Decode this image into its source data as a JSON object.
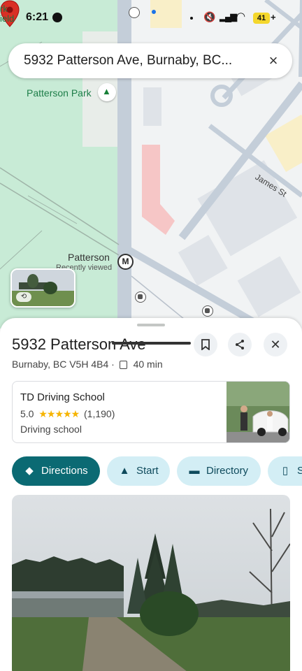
{
  "status_bar": {
    "corner_text": "rk\nield",
    "time": "6:21",
    "battery": "41",
    "battery_suffix": "+"
  },
  "search": {
    "query": "5932 Patterson Ave, Burnaby, BC...",
    "close_icon": "×"
  },
  "map": {
    "park_label": "Patterson Park",
    "street_label": "James St",
    "station_label": "Patterson",
    "recently_viewed": "Recently viewed",
    "metro_symbol": "M",
    "colors": {
      "park": "#c8ebd6",
      "road": "#c4ced9",
      "pin": "#d93025"
    }
  },
  "place": {
    "title": "5932 Patterson Ave",
    "address": "Burnaby, BC V5H 4B4 ·",
    "transit_time": "40 min"
  },
  "business": {
    "name": "TD Driving School",
    "rating": "5.0",
    "stars": "★★★★★",
    "reviews": "(1,190)",
    "category": "Driving school"
  },
  "actions": {
    "directions": "Directions",
    "start": "Start",
    "directory": "Directory",
    "save": "Sa"
  },
  "icons": {
    "bookmark": "bookmark-icon",
    "share": "share-icon",
    "close": "close-icon",
    "directions": "directions-diamond-icon",
    "navigation": "navigation-arrow-icon",
    "store": "store-icon"
  }
}
